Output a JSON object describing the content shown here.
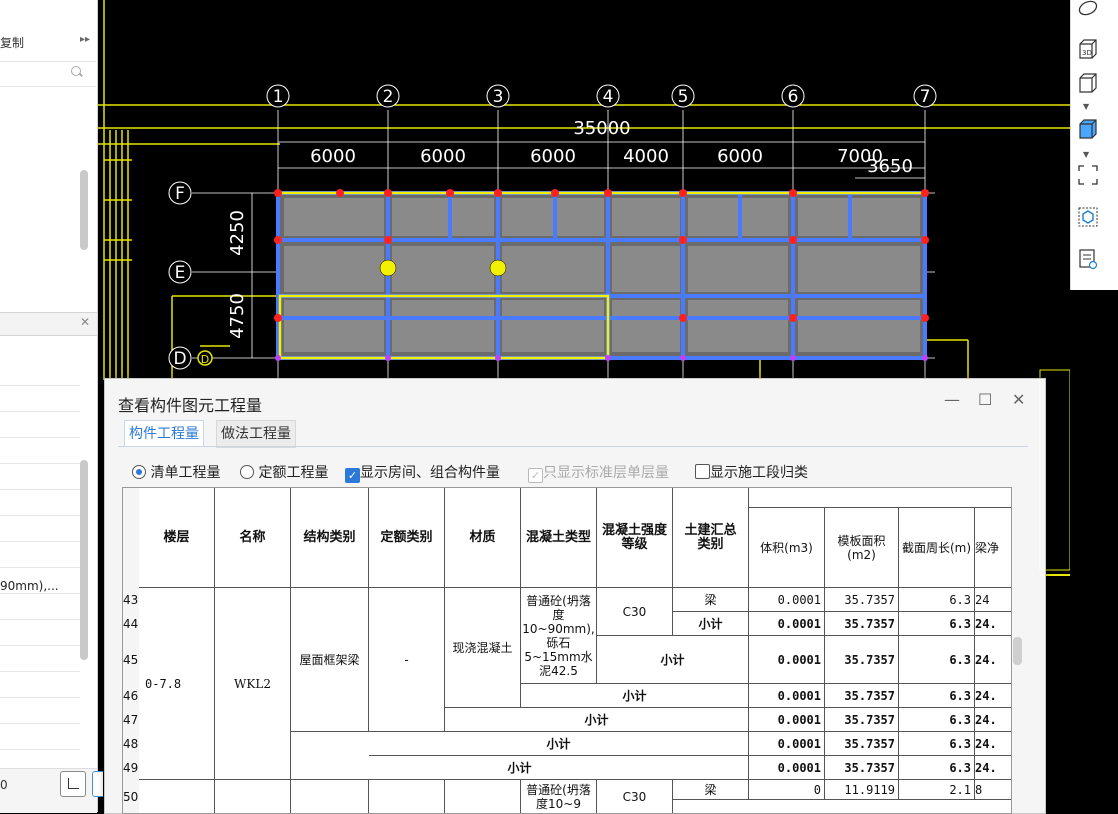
{
  "left_panel": {
    "tab_label": "复制",
    "more": "▸▸",
    "row_text": "90mm),...",
    "bottom_left_text": "0"
  },
  "cad": {
    "axis_numbers": [
      "1",
      "2",
      "3",
      "4",
      "5",
      "6",
      "7"
    ],
    "axis_letters": [
      "F",
      "E",
      "D"
    ],
    "small_axis_label": "D",
    "overall_dim": "35000",
    "spans": [
      "6000",
      "6000",
      "6000",
      "4000",
      "6000",
      "7000",
      "3650"
    ],
    "vertical_dims": [
      "4250",
      "4750"
    ]
  },
  "dialog": {
    "title": "查看构件图元工程量",
    "controls": {
      "minimize": "—",
      "maximize": "☐",
      "close": "✕"
    },
    "tabs": [
      "构件工程量",
      "做法工程量"
    ],
    "options": {
      "radio_bill": "清单工程量",
      "radio_quota": "定额工程量",
      "chk_room": "显示房间、组合构件量",
      "chk_std": "只显示标准层单层量",
      "chk_stage": "显示施工段归类"
    },
    "table": {
      "headers": [
        "楼层",
        "名称",
        "结构类别",
        "定额类别",
        "材质",
        "混凝土类型",
        "混凝土强度等级",
        "土建汇总类别",
        "体积(m3)",
        "模板面积(m2)",
        "截面周长(m)",
        "梁净"
      ],
      "floor": "0-7.8",
      "name": "WKL2",
      "struct": "屋面框架梁",
      "quota": "-",
      "material": "现浇混凝土",
      "concrete_type": "普通砼(坍落度10~90mm),砾石5~15mm水泥42.5",
      "concrete_type_2": "普通砼(坍落度10~9",
      "grade": "C30",
      "cat_beam": "梁",
      "subtotal": "小计",
      "rows": [
        {
          "no": "43",
          "vol": "0.0001",
          "form": "35.7357",
          "peri": "6.3",
          "net": "24"
        },
        {
          "no": "44",
          "vol": "0.0001",
          "form": "35.7357",
          "peri": "6.3",
          "net": "24."
        },
        {
          "no": "45",
          "vol": "0.0001",
          "form": "35.7357",
          "peri": "6.3",
          "net": "24."
        },
        {
          "no": "46",
          "vol": "0.0001",
          "form": "35.7357",
          "peri": "6.3",
          "net": "24."
        },
        {
          "no": "47",
          "vol": "0.0001",
          "form": "35.7357",
          "peri": "6.3",
          "net": "24."
        },
        {
          "no": "48",
          "vol": "0.0001",
          "form": "35.7357",
          "peri": "6.3",
          "net": "24."
        },
        {
          "no": "49",
          "vol": "0.0001",
          "form": "35.7357",
          "peri": "6.3",
          "net": "24."
        },
        {
          "no": "50",
          "vol": "0",
          "form": "11.9119",
          "peri": "2.1",
          "net": "8"
        }
      ]
    }
  }
}
